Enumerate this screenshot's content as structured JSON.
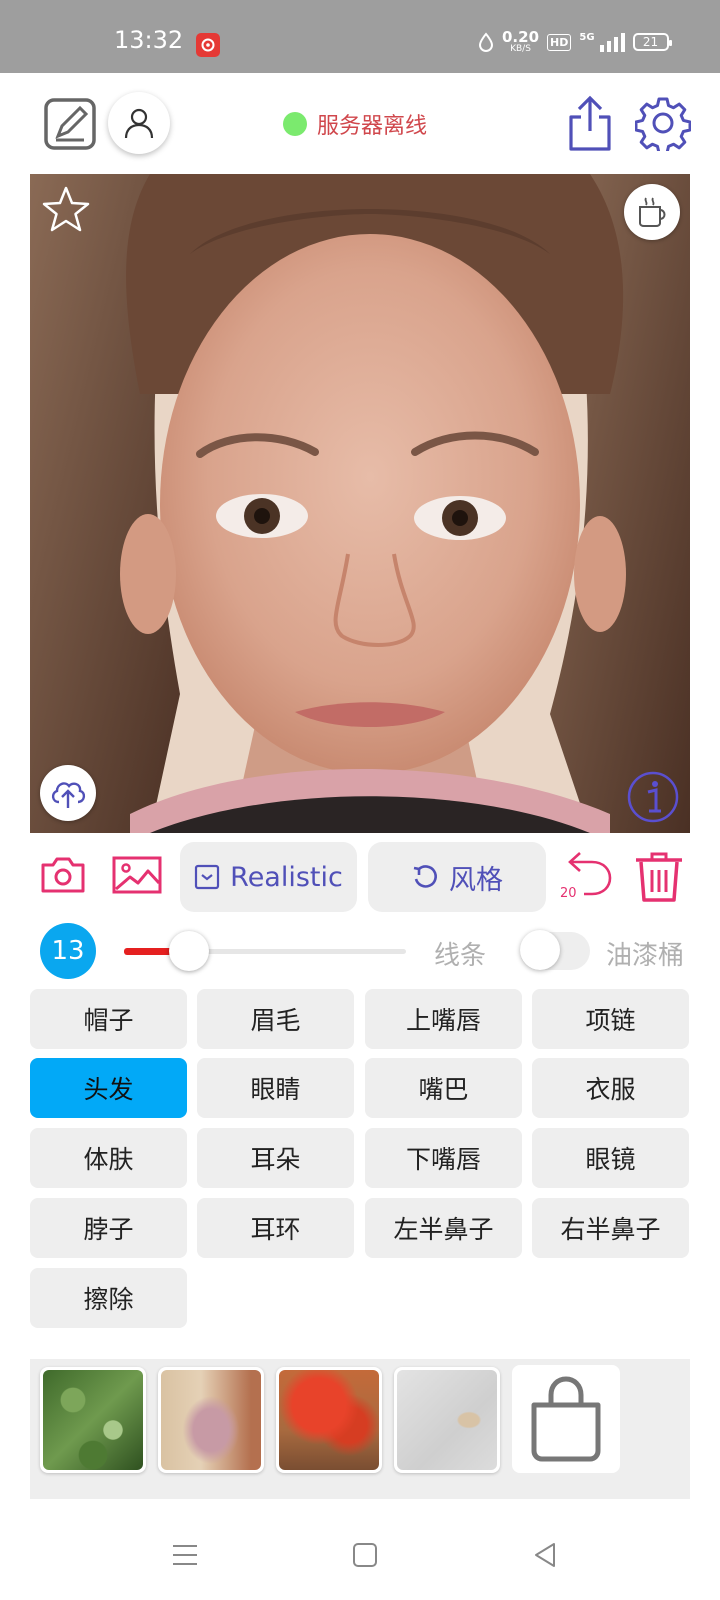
{
  "status_bar": {
    "time": "13:32",
    "net_speed_value": "0.20",
    "net_speed_unit": "KB/S",
    "hd_badge": "HD",
    "network_type": "5G",
    "battery": "21"
  },
  "toolbar": {
    "server_status": "服务器离线",
    "status_color": "#7bea6e"
  },
  "actions": {
    "model_label": "Realistic",
    "style_label": "风格",
    "undo_count": "20"
  },
  "brush": {
    "size": "13",
    "slider_fraction": 0.23,
    "line_label": "线条",
    "bucket_label": "油漆桶",
    "bucket_enabled": false
  },
  "parts": [
    {
      "label": "帽子",
      "selected": false
    },
    {
      "label": "眉毛",
      "selected": false
    },
    {
      "label": "上嘴唇",
      "selected": false
    },
    {
      "label": "项链",
      "selected": false
    },
    {
      "label": "头发",
      "selected": true
    },
    {
      "label": "眼睛",
      "selected": false
    },
    {
      "label": "嘴巴",
      "selected": false
    },
    {
      "label": "衣服",
      "selected": false
    },
    {
      "label": "体肤",
      "selected": false
    },
    {
      "label": "耳朵",
      "selected": false
    },
    {
      "label": "下嘴唇",
      "selected": false
    },
    {
      "label": "眼镜",
      "selected": false
    },
    {
      "label": "脖子",
      "selected": false
    },
    {
      "label": "耳环",
      "selected": false
    },
    {
      "label": "左半鼻子",
      "selected": false
    },
    {
      "label": "右半鼻子",
      "selected": false
    },
    {
      "label": "擦除",
      "selected": false
    }
  ],
  "textures": [
    "green-foliage",
    "pink-blossom-vase",
    "red-flowers",
    "gray-stone"
  ],
  "colors": {
    "accent_pink": "#e53170",
    "accent_purple": "#5050b8",
    "selected_blue": "#02a9f7"
  }
}
